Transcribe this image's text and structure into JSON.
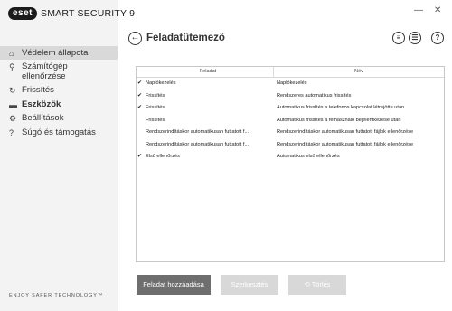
{
  "app": {
    "logo": "eset",
    "product": "SMART SECURITY 9"
  },
  "window": {
    "minimize": "—",
    "close": "✕"
  },
  "nav": [
    {
      "icon": "home-icon",
      "glyph": "⌂",
      "label": "Védelem állapota",
      "active": true,
      "bold": false
    },
    {
      "icon": "search-icon",
      "glyph": "⚲",
      "label": "Számítógép ellenőrzése",
      "active": false,
      "bold": false
    },
    {
      "icon": "refresh-icon",
      "glyph": "↻",
      "label": "Frissítés",
      "active": false,
      "bold": false
    },
    {
      "icon": "briefcase-icon",
      "glyph": "▬",
      "label": "Eszközök",
      "active": false,
      "bold": true
    },
    {
      "icon": "gear-icon",
      "glyph": "⚙",
      "label": "Beállítások",
      "active": false,
      "bold": false
    },
    {
      "icon": "help-icon",
      "glyph": "?",
      "label": "Súgó és támogatás",
      "active": false,
      "bold": false
    }
  ],
  "tagline": "ENJOY SAFER TECHNOLOGY™",
  "header": {
    "title": "Feladatütemező"
  },
  "table": {
    "columns": [
      "Feladat",
      "Név"
    ],
    "rows": [
      {
        "checked": true,
        "task": "Naplókezelés",
        "name": "Naplókezelés"
      },
      {
        "checked": true,
        "task": "Frissítés",
        "name": "Rendszeres automatikus frissítés"
      },
      {
        "checked": true,
        "task": "Frissítés",
        "name": "Automatikus frissítés a telefonos kapcsolat létrejötte után"
      },
      {
        "checked": false,
        "task": "Frissítés",
        "name": "Automatikus frissítés a felhasználó bejelentkezése után"
      },
      {
        "checked": false,
        "task": "Rendszerindításkor automatikusan futtatott f...",
        "name": "Rendszerindításkor automatikusan futtatott fájlok ellenőrzése"
      },
      {
        "checked": false,
        "task": "Rendszerindításkor automatikusan futtatott f...",
        "name": "Rendszerindításkor automatikusan futtatott fájlok ellenőrzése"
      },
      {
        "checked": true,
        "task": "Első ellenőrzés",
        "name": "Automatikus első ellenőrzés"
      }
    ]
  },
  "buttons": {
    "add": "Feladat hozzáadása",
    "edit": "Szerkesztés",
    "delete": "Törlés"
  }
}
